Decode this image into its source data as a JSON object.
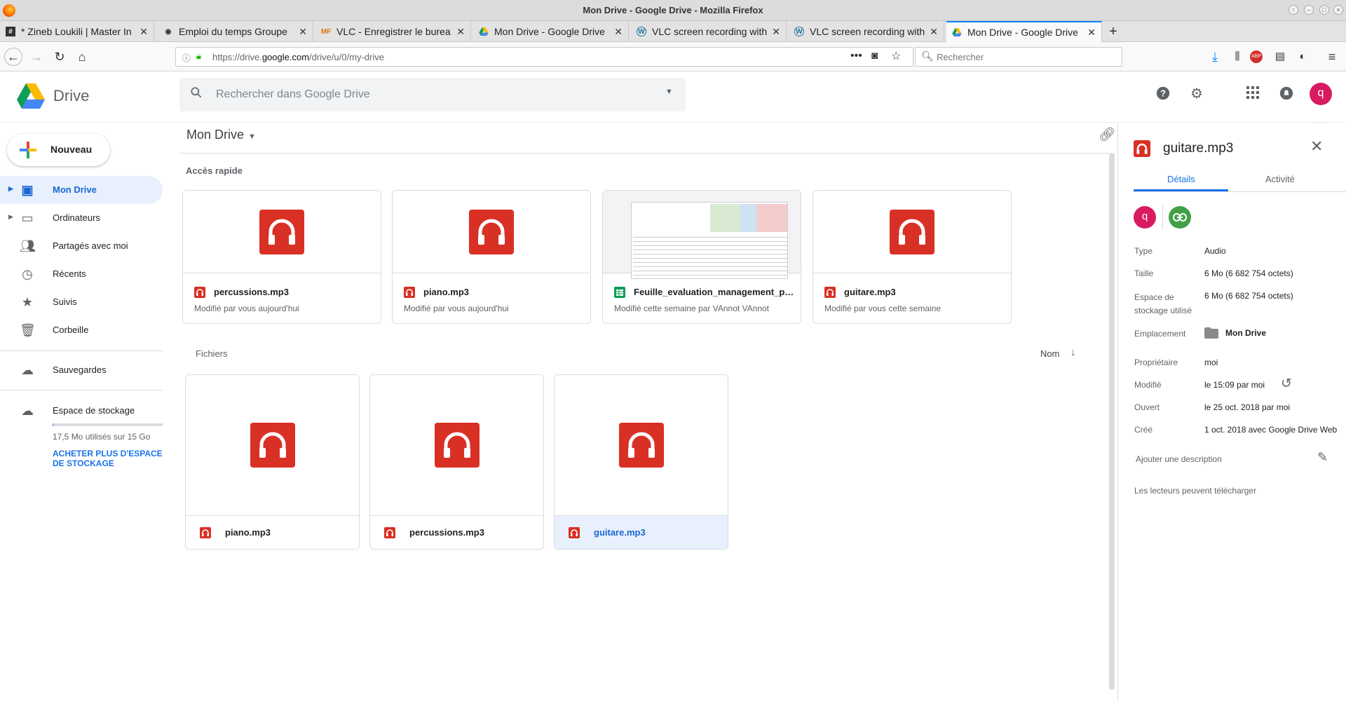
{
  "browser": {
    "window_title": "Mon Drive - Google Drive - Mozilla Firefox",
    "tabs": [
      {
        "label": "* Zineb Loukili | Master In",
        "icon": "hash-icon"
      },
      {
        "label": "Emploi du temps Groupe",
        "icon": "camera-icon"
      },
      {
        "label": "VLC - Enregistrer le burea",
        "icon": "mf-icon"
      },
      {
        "label": "Mon Drive - Google Drive",
        "icon": "google-drive-icon"
      },
      {
        "label": "VLC screen recording with",
        "icon": "wordpress-icon"
      },
      {
        "label": "VLC screen recording with",
        "icon": "wordpress-icon"
      },
      {
        "label": "Mon Drive - Google Drive",
        "icon": "google-drive-icon",
        "active": true
      }
    ],
    "url_prefix": "https://drive.",
    "url_domain": "google.com",
    "url_suffix": "/drive/u/0/my-drive",
    "search_placeholder": "Rechercher"
  },
  "drive": {
    "logo_text": "Drive",
    "search_placeholder": "Rechercher dans Google Drive",
    "avatar_letter": "q",
    "new_button": "Nouveau",
    "sidebar": [
      {
        "label": "Mon Drive",
        "icon": "my-drive-icon",
        "active": true,
        "expandable": true
      },
      {
        "label": "Ordinateurs",
        "icon": "computers-icon",
        "expandable": true
      },
      {
        "label": "Partagés avec moi",
        "icon": "people-icon"
      },
      {
        "label": "Récents",
        "icon": "clock-icon"
      },
      {
        "label": "Suivis",
        "icon": "star-icon"
      },
      {
        "label": "Corbeille",
        "icon": "trash-icon"
      }
    ],
    "backups_label": "Sauvegardes",
    "storage": {
      "title": "Espace de stockage",
      "used_text": "17,5 Mo utilisés sur 15 Go",
      "used_fraction": 0.00117,
      "buy_link": "ACHETER PLUS D'ESPACE DE STOCKAGE"
    },
    "breadcrumb": "Mon Drive",
    "quick_access_title": "Accès rapide",
    "quick_access": [
      {
        "name": "percussions.mp3",
        "sub": "Modifié par vous aujourd'hui",
        "type": "audio"
      },
      {
        "name": "piano.mp3",
        "sub": "Modifié par vous aujourd'hui",
        "type": "audio"
      },
      {
        "name": "Feuille_evaluation_management_proj...",
        "sub": "Modifié cette semaine par VAnnot VAnnot",
        "type": "sheet"
      },
      {
        "name": "guitare.mp3",
        "sub": "Modifié par vous cette semaine",
        "type": "audio"
      }
    ],
    "files_title": "Fichiers",
    "sort_label": "Nom",
    "files": [
      {
        "name": "piano.mp3",
        "selected": false
      },
      {
        "name": "percussions.mp3",
        "selected": false
      },
      {
        "name": "guitare.mp3",
        "selected": true
      }
    ],
    "details": {
      "file_name": "guitare.mp3",
      "tab_details": "Détails",
      "tab_activity": "Activité",
      "owner_letter": "q",
      "rows": [
        {
          "key": "Type",
          "value": "Audio"
        },
        {
          "key": "Taille",
          "value": "6 Mo (6 682 754 octets)"
        },
        {
          "key": "Espace de stockage utilisé",
          "value": "6 Mo (6 682 754 octets)"
        },
        {
          "key": "Emplacement",
          "value": "Mon Drive"
        },
        {
          "key": "Propriétaire",
          "value": "moi"
        },
        {
          "key": "Modifié",
          "value": "le 15:09 par moi"
        },
        {
          "key": "Ouvert",
          "value": "le 25 oct. 2018 par moi"
        },
        {
          "key": "Créé",
          "value": "1 oct. 2018 avec Google Drive Web"
        }
      ],
      "add_description": "Ajouter une description",
      "readers_download": "Les lecteurs peuvent télécharger"
    }
  },
  "colors": {
    "accent": "#1a73e8",
    "audio_red": "#d93025",
    "sheet_green": "#0f9d58",
    "avatar_pink": "#d81b60",
    "link_green": "#43a047"
  }
}
